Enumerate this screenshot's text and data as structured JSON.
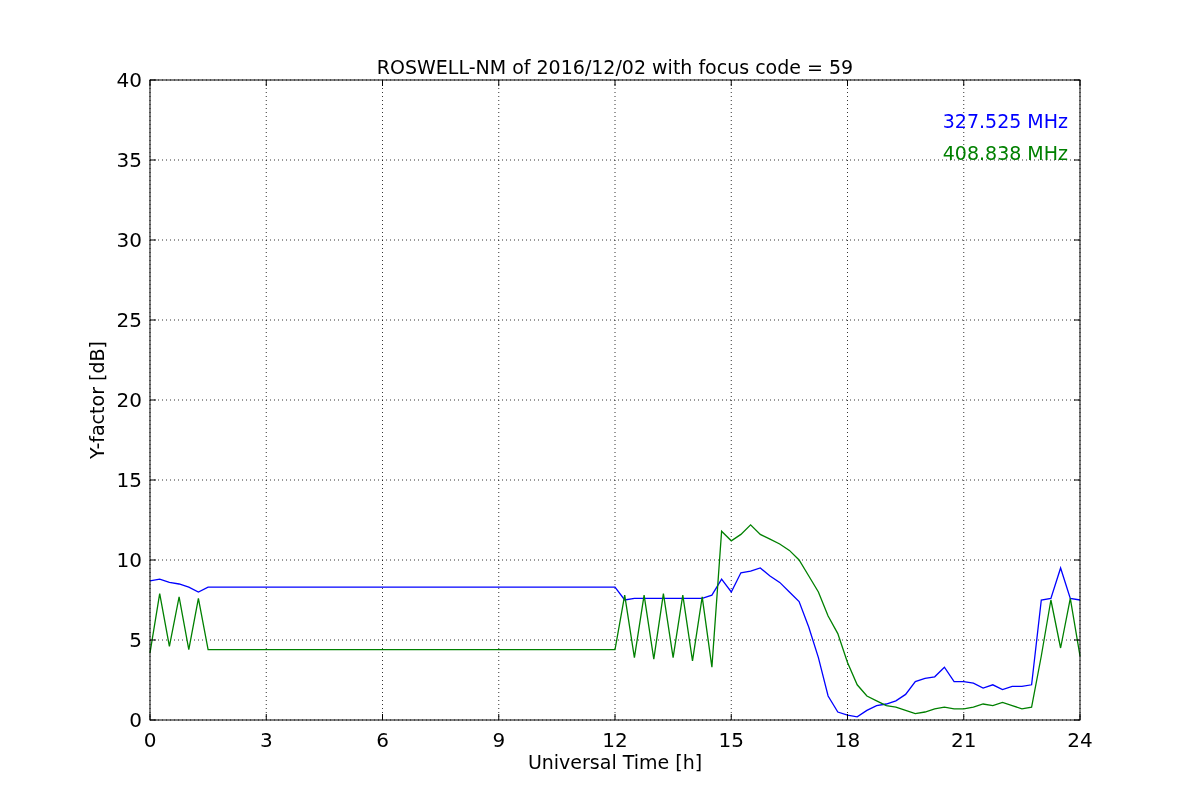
{
  "chart": {
    "chart_data": {
      "type": "line",
      "title": "ROSWELL-NM of 2016/12/02 with focus code = 59",
      "xlabel": "Universal Time [h]",
      "ylabel": "Y-factor [dB]",
      "x": [
        0,
        0.25,
        0.5,
        0.75,
        1,
        1.25,
        1.5,
        1.75,
        2,
        2.25,
        2.5,
        2.75,
        3,
        3.25,
        3.5,
        3.75,
        4,
        4.25,
        4.5,
        4.75,
        5,
        5.25,
        5.5,
        5.75,
        6,
        6.25,
        6.5,
        6.75,
        7,
        7.25,
        7.5,
        7.75,
        8,
        8.25,
        8.5,
        8.75,
        9,
        9.25,
        9.5,
        9.75,
        10,
        10.25,
        10.5,
        10.75,
        11,
        11.25,
        11.5,
        11.75,
        12,
        12.25,
        12.5,
        12.75,
        13,
        13.25,
        13.5,
        13.75,
        14,
        14.25,
        14.5,
        14.75,
        15,
        15.25,
        15.5,
        15.75,
        16,
        16.25,
        16.5,
        16.75,
        17,
        17.25,
        17.5,
        17.75,
        18,
        18.25,
        18.5,
        18.75,
        19,
        19.25,
        19.5,
        19.75,
        20,
        20.25,
        20.5,
        20.75,
        21,
        21.25,
        21.5,
        21.75,
        22,
        22.25,
        22.5,
        22.75,
        23,
        23.25,
        23.5,
        23.75,
        24
      ],
      "series": [
        {
          "name": "327.525 MHz",
          "color": "#0000ff",
          "values": [
            8.7,
            8.8,
            8.6,
            8.5,
            8.3,
            8.0,
            8.3,
            8.3,
            8.3,
            8.3,
            8.3,
            8.3,
            8.3,
            8.3,
            8.3,
            8.3,
            8.3,
            8.3,
            8.3,
            8.3,
            8.3,
            8.3,
            8.3,
            8.3,
            8.3,
            8.3,
            8.3,
            8.3,
            8.3,
            8.3,
            8.3,
            8.3,
            8.3,
            8.3,
            8.3,
            8.3,
            8.3,
            8.3,
            8.3,
            8.3,
            8.3,
            8.3,
            8.3,
            8.3,
            8.3,
            8.3,
            8.3,
            8.3,
            8.3,
            7.5,
            7.6,
            7.6,
            7.6,
            7.6,
            7.6,
            7.6,
            7.6,
            7.6,
            7.8,
            8.8,
            8.0,
            9.2,
            9.3,
            9.5,
            9.0,
            8.6,
            8.0,
            7.4,
            5.8,
            3.9,
            1.5,
            0.5,
            0.3,
            0.2,
            0.6,
            0.9,
            1.0,
            1.2,
            1.6,
            2.4,
            2.6,
            2.7,
            3.3,
            2.4,
            2.4,
            2.3,
            2.0,
            2.2,
            1.9,
            2.1,
            2.1,
            2.2,
            7.5,
            7.6,
            9.5,
            7.6,
            7.5
          ]
        },
        {
          "name": "408.838 MHz",
          "color": "#008000",
          "values": [
            4.2,
            7.9,
            4.6,
            7.7,
            4.4,
            7.6,
            4.4,
            4.4,
            4.4,
            4.4,
            4.4,
            4.4,
            4.4,
            4.4,
            4.4,
            4.4,
            4.4,
            4.4,
            4.4,
            4.4,
            4.4,
            4.4,
            4.4,
            4.4,
            4.4,
            4.4,
            4.4,
            4.4,
            4.4,
            4.4,
            4.4,
            4.4,
            4.4,
            4.4,
            4.4,
            4.4,
            4.4,
            4.4,
            4.4,
            4.4,
            4.4,
            4.4,
            4.4,
            4.4,
            4.4,
            4.4,
            4.4,
            4.4,
            4.4,
            7.8,
            3.9,
            7.8,
            3.8,
            7.9,
            3.9,
            7.8,
            3.7,
            7.7,
            3.3,
            11.8,
            11.2,
            11.6,
            12.2,
            11.6,
            11.3,
            11.0,
            10.6,
            10.0,
            9.0,
            8.0,
            6.5,
            5.4,
            3.6,
            2.2,
            1.5,
            1.2,
            0.9,
            0.8,
            0.6,
            0.4,
            0.5,
            0.7,
            0.8,
            0.7,
            0.7,
            0.8,
            1.0,
            0.9,
            1.1,
            0.9,
            0.7,
            0.8,
            4.0,
            7.5,
            4.5,
            7.6,
            4.0
          ]
        }
      ],
      "grid": true,
      "xlim": [
        0,
        24
      ],
      "ylim": [
        0,
        40
      ],
      "xticks": [
        0,
        3,
        6,
        9,
        12,
        15,
        18,
        21,
        24
      ],
      "yticks": [
        0,
        5,
        10,
        15,
        20,
        25,
        30,
        35,
        40
      ]
    }
  }
}
